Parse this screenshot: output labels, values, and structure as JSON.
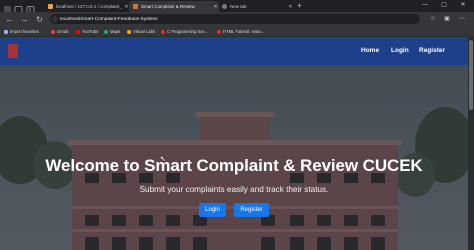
{
  "browser": {
    "tabs": [
      {
        "title": "localhost / 127.0.0.1 / complaint_",
        "favicon_color": "#e0a84c"
      },
      {
        "title": "Smart Complaint & Review",
        "favicon_color": "#e46f3a"
      },
      {
        "title": "New tab",
        "favicon_color": "#7a7c80"
      }
    ],
    "url": "localhost/Smart-Complaint-Feedback-System/",
    "bookmarks": [
      {
        "label": "Import favorites",
        "color": "#8ab4f8"
      },
      {
        "label": "Gmail",
        "color": "#ea4335"
      },
      {
        "label": "YouTube",
        "color": "#ff0000"
      },
      {
        "label": "Maps",
        "color": "#34a853"
      },
      {
        "label": "Virtual Labs",
        "color": "#f9ab00"
      },
      {
        "label": "C Programming Exe...",
        "color": "#d93025"
      },
      {
        "label": "HTML Tutorial: Insta...",
        "color": "#d93025"
      }
    ]
  },
  "site": {
    "nav": {
      "home": "Home",
      "login": "Login",
      "register": "Register"
    },
    "hero": {
      "title": "Welcome to Smart Complaint & Review CUCEK",
      "subtitle": "Submit your complaints easily and track their status.",
      "login_button": "Login",
      "register_button": "Register"
    }
  },
  "colors": {
    "navbar": "#1e3f8a",
    "button": "#1976e8",
    "logo": "#a8313a"
  }
}
